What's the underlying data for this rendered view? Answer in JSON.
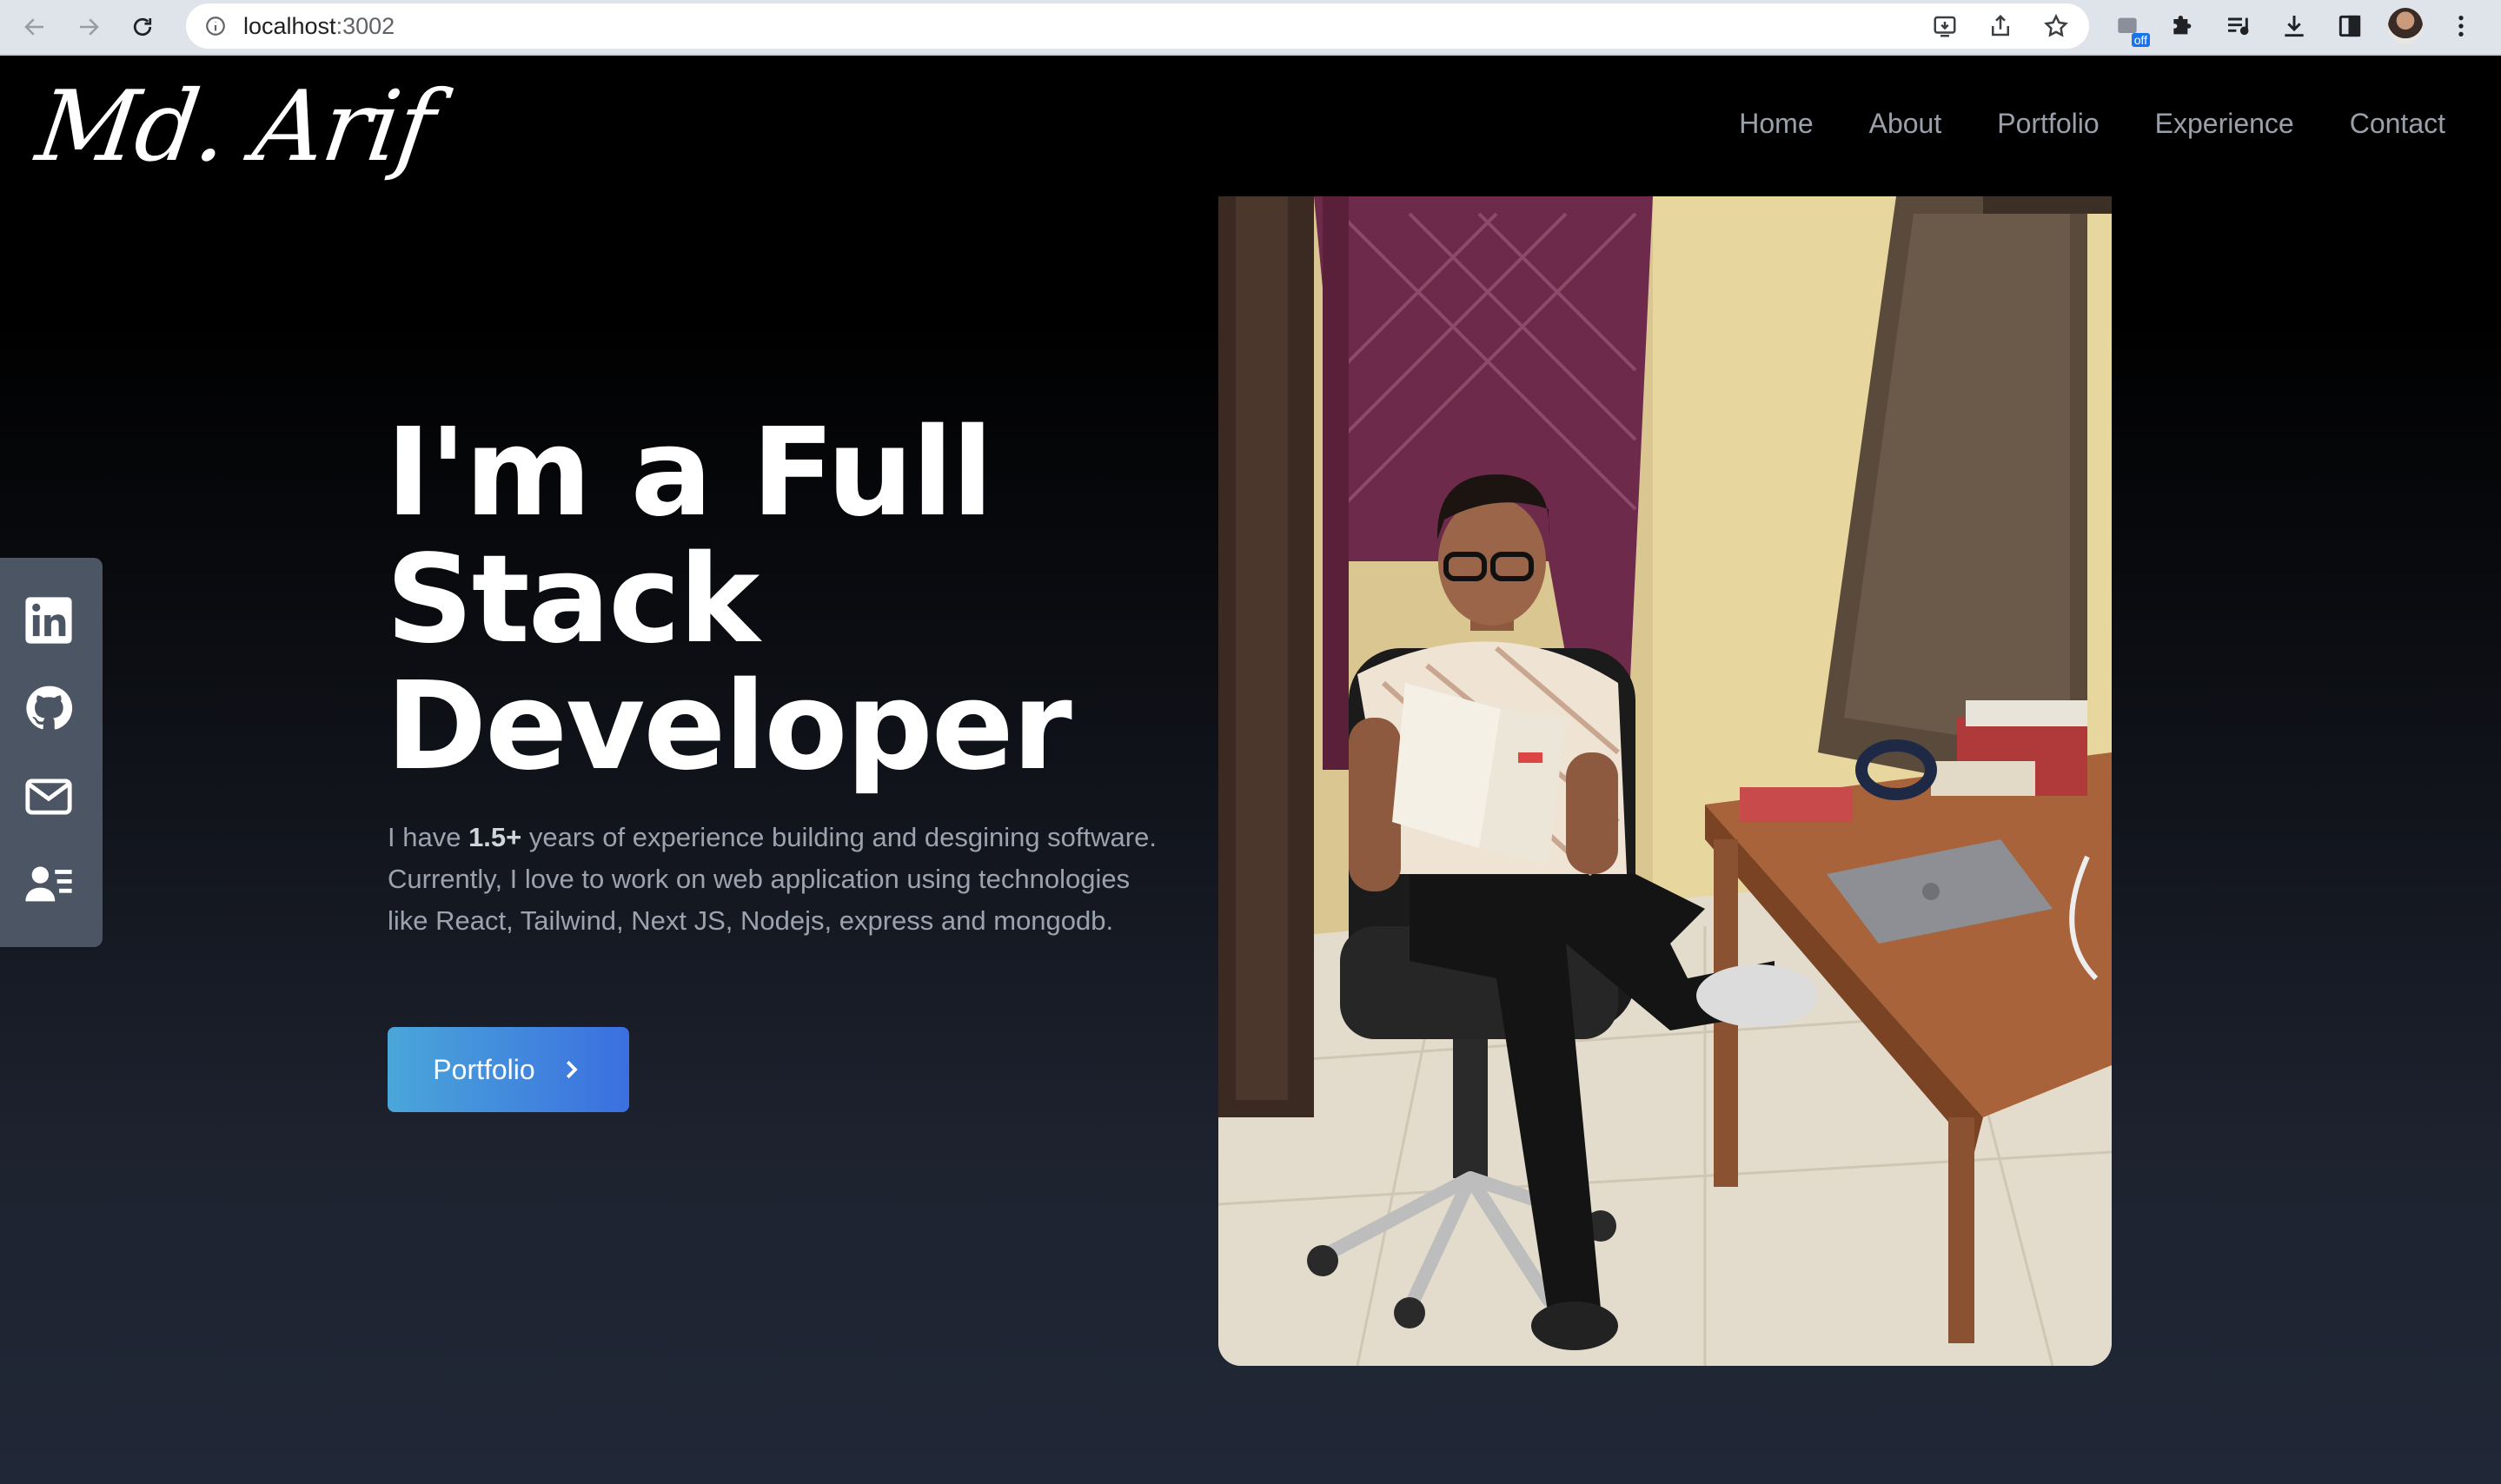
{
  "browser": {
    "url_host": "localhost",
    "url_port": ":3002",
    "extension_badge": "off"
  },
  "site": {
    "logo": "Md. Arif",
    "nav": [
      "Home",
      "About",
      "Portfolio",
      "Experience",
      "Contact"
    ]
  },
  "social": [
    "linkedin-icon",
    "github-icon",
    "mail-icon",
    "contact-card-icon"
  ],
  "hero": {
    "title_lines": [
      "I'm a Full",
      "Stack",
      "Developer"
    ],
    "desc_before": "I have ",
    "desc_bold": "1.5+",
    "desc_after": " years of experience building and desgining software. Currently, I love to work on web application using technologies like React, Tailwind, Next JS, Nodejs, express and mongodb.",
    "button_label": "Portfolio"
  },
  "colors": {
    "accent_start": "#4aa6d9",
    "accent_end": "#3b6fe0",
    "nav_text": "#9aa0aa",
    "social_bg": "#4b5563"
  }
}
